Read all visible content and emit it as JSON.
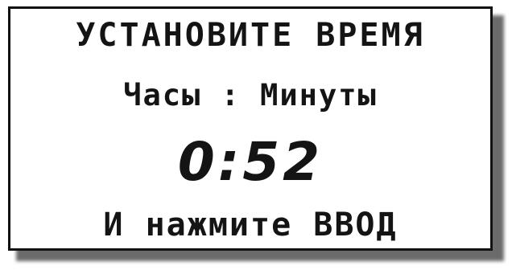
{
  "screen": {
    "title": "УСТАНОВИТЕ ВРЕМЯ",
    "subtitle": "Часы : Минуты",
    "time_value": "0:52",
    "hint": "И нажмите ВВОД"
  }
}
